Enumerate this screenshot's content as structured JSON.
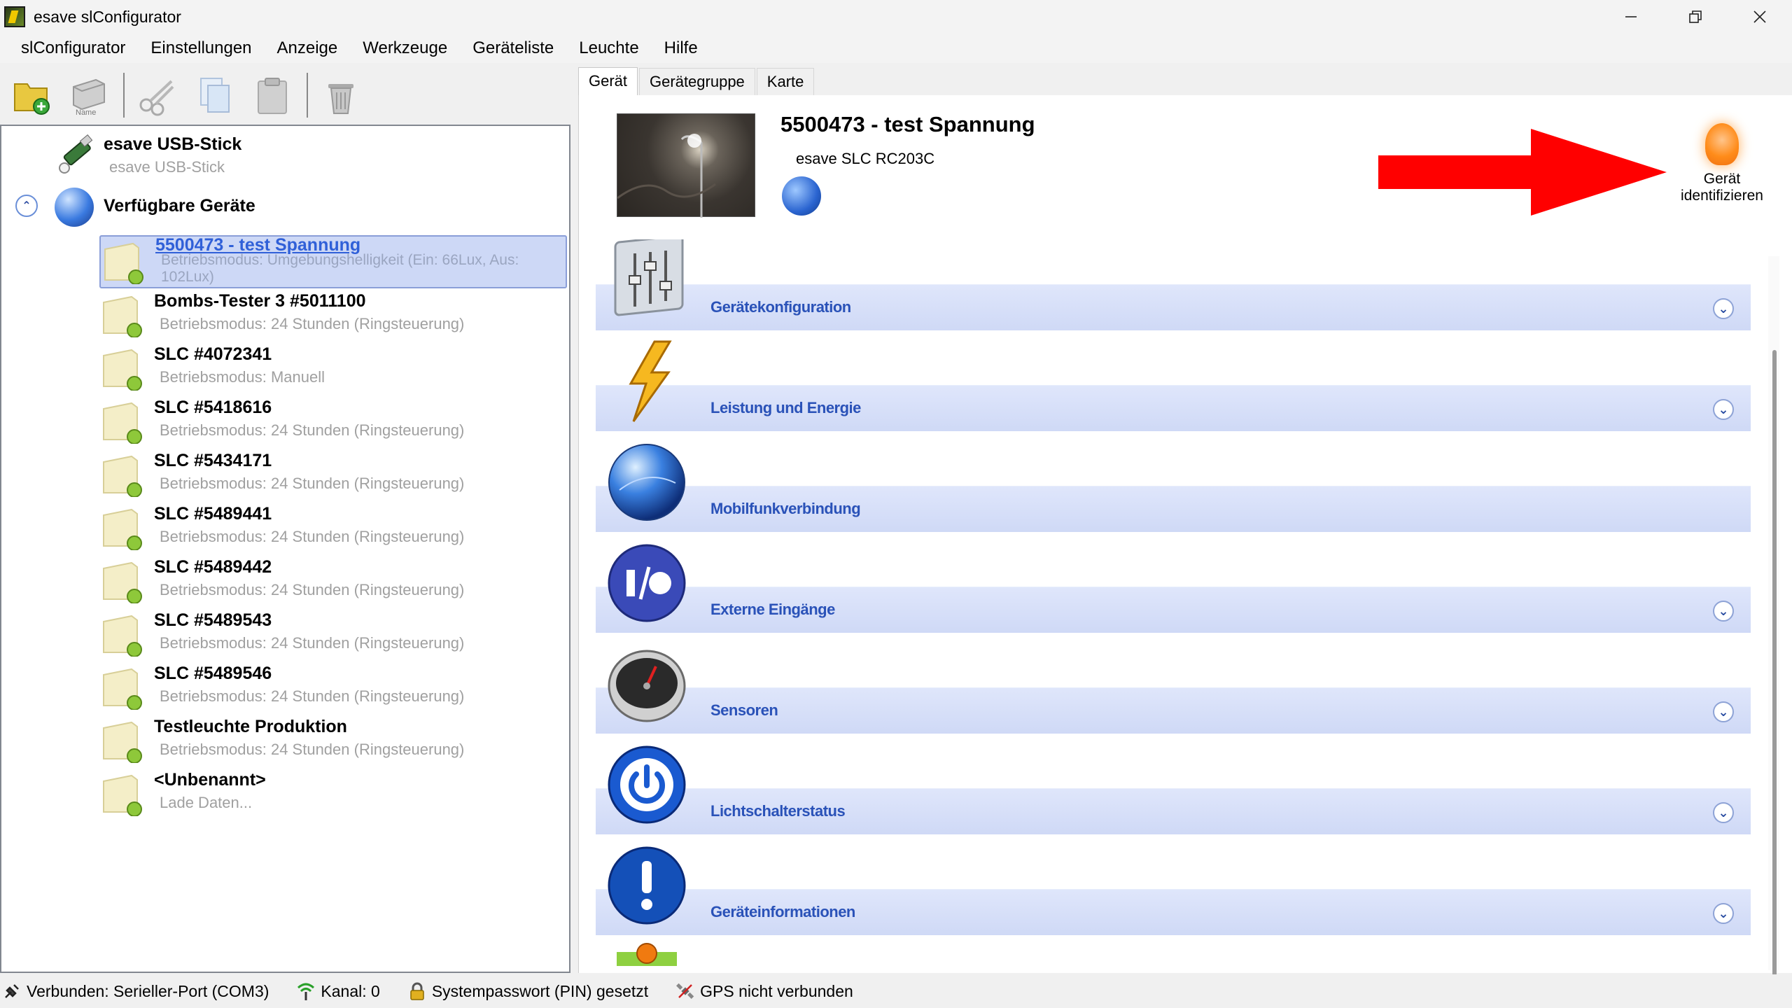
{
  "window": {
    "title": "esave slConfigurator"
  },
  "menu": [
    "slConfigurator",
    "Einstellungen",
    "Anzeige",
    "Werkzeuge",
    "Geräteliste",
    "Leuchte",
    "Hilfe"
  ],
  "toolbar": {
    "name_label": "Name"
  },
  "tree": {
    "usb": {
      "title": "esave USB-Stick",
      "subtitle": "esave USB-Stick"
    },
    "available": {
      "title": "Verfügbare Geräte"
    },
    "devices": [
      {
        "title": "5500473 - test Spannung",
        "subtitle": "Betriebsmodus: Umgebungshelligkeit (Ein: 66Lux, Aus: 102Lux)"
      },
      {
        "title": "Bombs-Tester 3 #5011100",
        "subtitle": "Betriebsmodus: 24 Stunden (Ringsteuerung)"
      },
      {
        "title": "SLC #4072341",
        "subtitle": "Betriebsmodus: Manuell"
      },
      {
        "title": "SLC #5418616",
        "subtitle": "Betriebsmodus: 24 Stunden (Ringsteuerung)"
      },
      {
        "title": "SLC #5434171",
        "subtitle": "Betriebsmodus: 24 Stunden (Ringsteuerung)"
      },
      {
        "title": "SLC #5489441",
        "subtitle": "Betriebsmodus: 24 Stunden (Ringsteuerung)"
      },
      {
        "title": "SLC #5489442",
        "subtitle": "Betriebsmodus: 24 Stunden (Ringsteuerung)"
      },
      {
        "title": "SLC #5489543",
        "subtitle": "Betriebsmodus: 24 Stunden (Ringsteuerung)"
      },
      {
        "title": "SLC #5489546",
        "subtitle": "Betriebsmodus: 24 Stunden (Ringsteuerung)"
      },
      {
        "title": "Testleuchte Produktion",
        "subtitle": "Betriebsmodus: 24 Stunden (Ringsteuerung)"
      },
      {
        "title": "<Unbenannt>",
        "subtitle": "Lade Daten..."
      }
    ]
  },
  "tabs": [
    "Gerät",
    "Gerätegruppe",
    "Karte"
  ],
  "device": {
    "name": "5500473 - test Spannung",
    "type": "esave SLC RC203C",
    "identify_line1": "Gerät",
    "identify_line2": "identifizieren"
  },
  "sections": [
    {
      "label": "Gerätekonfiguration",
      "icon": "sliders-icon",
      "expandable": true
    },
    {
      "label": "Leistung und Energie",
      "icon": "lightning-icon",
      "expandable": true
    },
    {
      "label": "Mobilfunkverbindung",
      "icon": "globe-icon",
      "expandable": false
    },
    {
      "label": "Externe Eingänge",
      "icon": "io-icon",
      "expandable": true
    },
    {
      "label": "Sensoren",
      "icon": "gauge-icon",
      "expandable": true
    },
    {
      "label": "Lichtschalterstatus",
      "icon": "power-icon",
      "expandable": true
    },
    {
      "label": "Geräteinformationen",
      "icon": "info-icon",
      "expandable": true
    }
  ],
  "status": {
    "connection": "Verbunden: Serieller-Port (COM3)",
    "channel": "Kanal: 0",
    "pin": "Systempasswort (PIN) gesetzt",
    "gps": "GPS nicht verbunden"
  },
  "colors": {
    "accent": "#2a52b8",
    "section_bar": "#d6dff8",
    "selection": "#cdd8f6",
    "arrow": "#ff0000"
  }
}
